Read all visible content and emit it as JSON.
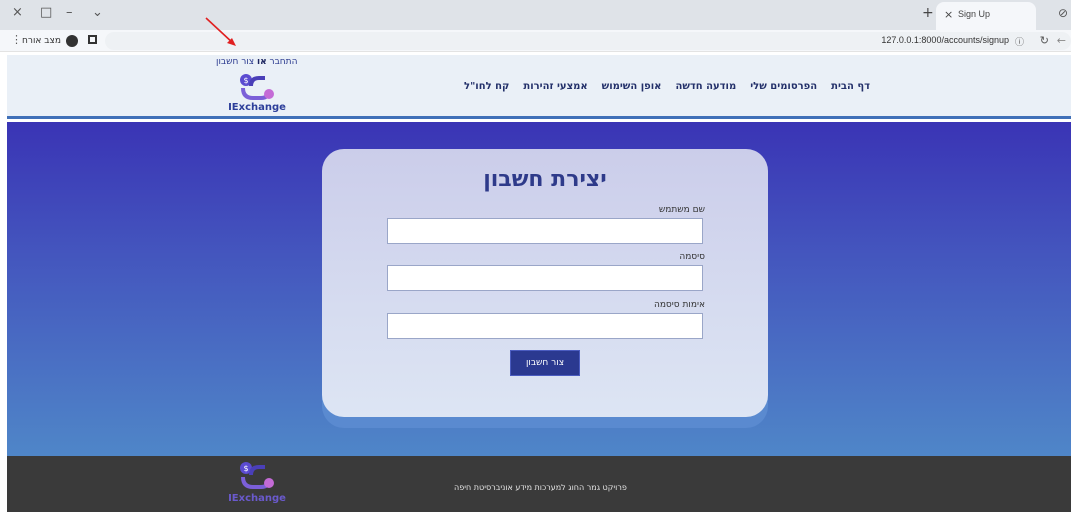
{
  "browser": {
    "tab_title": "Sign Up",
    "tab_close": "×",
    "new_tab": "+",
    "url": "127.0.0.1:8000/accounts/signup",
    "guest_label": "מצב אורח",
    "window_controls": [
      "×",
      "□",
      "–",
      "⌄"
    ]
  },
  "site": {
    "auth": {
      "login": "התחבר",
      "or": "או",
      "signup": "צור חשבון"
    },
    "logo_text": "IExchange",
    "nav": [
      "דף הבית",
      "הפרסומים שלי",
      "מודעה חדשה",
      "אופן השימוש",
      "אמצעי זהירות",
      "קח לחו\"ל"
    ]
  },
  "form": {
    "title": "יצירת חשבון",
    "username_label": "שם משתמש",
    "password_label": "סיסמה",
    "confirm_label": "אימות סיסמה",
    "submit_label": "צור חשבון"
  },
  "footer": {
    "logo_text": "IExchange",
    "text": "פרויקט גמר החוג למערכות מידע אוניברסיטת חיפה"
  },
  "colors": {
    "primary": "#2b3990",
    "gradient_top": "#3a34b5",
    "gradient_bottom": "#4f86c8",
    "footer_bg": "#3a3a3a",
    "annotation_arrow": "#e02020"
  }
}
